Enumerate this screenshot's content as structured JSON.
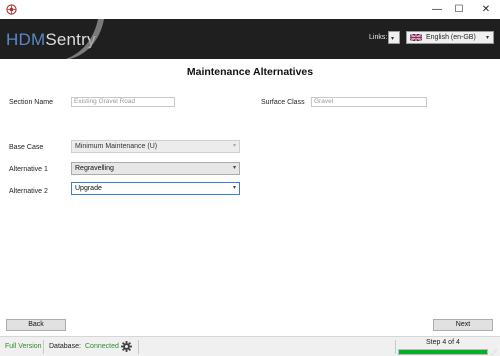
{
  "window": {
    "minimize_glyph": "—",
    "maximize_glyph": "☐",
    "close_glyph": "✕"
  },
  "header": {
    "logo_part1": "HDM",
    "logo_part2": "Sentry",
    "links_label": "Links:",
    "links_caret": "▾",
    "language_label": "English (en-GB)",
    "language_caret": "▾"
  },
  "page": {
    "title": "Maintenance Alternatives"
  },
  "section": {
    "section_name_label": "Section Name",
    "section_name_value": "Existing Gravel Road",
    "surface_class_label": "Surface Class",
    "surface_class_value": "Gravel"
  },
  "alternatives": {
    "base_case_label": "Base Case",
    "base_case_value": "Minimum Maintenance (U)",
    "alt1_label": "Alternative 1",
    "alt1_value": "Regravelling",
    "alt2_label": "Alternative 2",
    "alt2_value": "Upgrade",
    "caret": "▾"
  },
  "nav": {
    "back_label": "Back",
    "next_label": "Next"
  },
  "status": {
    "version": "Full Version",
    "database_label": "Database:",
    "database_status": "Connected",
    "step_text": "Step 4 of 4",
    "progress_fraction": 1.0
  },
  "colors": {
    "header_bg": "#1f1f1f",
    "logo_accent": "#5b87c7",
    "status_green": "#2e8b2e",
    "progress_green": "#06b025",
    "focus_blue": "#3b7fd4"
  }
}
